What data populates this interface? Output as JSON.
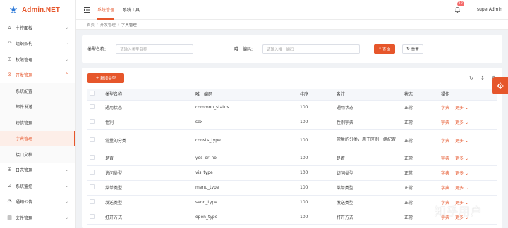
{
  "app": {
    "title": "Admin.NET",
    "brand_color": "#e6562b"
  },
  "sidebar": {
    "items": [
      {
        "label": "主控面板",
        "icon": "home-icon"
      },
      {
        "label": "组织架构",
        "icon": "org-icon"
      },
      {
        "label": "权限管理",
        "icon": "lock-icon"
      },
      {
        "label": "开发管理",
        "icon": "dev-icon",
        "open": true,
        "children": [
          {
            "label": "系统配置"
          },
          {
            "label": "邮件发送"
          },
          {
            "label": "短信管理"
          },
          {
            "label": "字典管理",
            "active": true
          },
          {
            "label": "接口文档"
          }
        ]
      },
      {
        "label": "日志管理",
        "icon": "log-icon"
      },
      {
        "label": "系统监控",
        "icon": "monitor-icon"
      },
      {
        "label": "通知公告",
        "icon": "notice-icon"
      },
      {
        "label": "文件管理",
        "icon": "file-icon"
      }
    ]
  },
  "topbar": {
    "tabs": [
      {
        "label": "系统管理",
        "active": true
      },
      {
        "label": "系统工具"
      }
    ],
    "notification_count": "12",
    "username": "superAdmin"
  },
  "breadcrumb": [
    "首页",
    "开发管理",
    "字典管理"
  ],
  "search": {
    "type_name_label": "类型名称:",
    "type_name_placeholder": "请输入类型名称",
    "code_label": "唯一编码:",
    "code_placeholder": "请输入唯一编码",
    "query_label": "查询",
    "reset_label": "重置"
  },
  "toolbar": {
    "add_label": "新增类型"
  },
  "table": {
    "columns": [
      "类型名称",
      "唯一编码",
      "排序",
      "备注",
      "状态",
      "操作"
    ],
    "rows": [
      {
        "name": "通用状态",
        "code": "common_status",
        "sort": "100",
        "remark": "通用状态",
        "status": "正常"
      },
      {
        "name": "性别",
        "code": "sex",
        "sort": "100",
        "remark": "性别字典",
        "status": "正常"
      },
      {
        "name": "常量的分类",
        "code": "consts_type",
        "sort": "100",
        "remark": "常量的分类，用于区别一组配置",
        "status": "正常",
        "tall": true
      },
      {
        "name": "是否",
        "code": "yes_or_no",
        "sort": "100",
        "remark": "是否",
        "status": "正常"
      },
      {
        "name": "访问类型",
        "code": "vis_type",
        "sort": "100",
        "remark": "访问类型",
        "status": "正常"
      },
      {
        "name": "菜单类型",
        "code": "menu_type",
        "sort": "100",
        "remark": "菜单类型",
        "status": "正常"
      },
      {
        "name": "发送类型",
        "code": "send_type",
        "sort": "100",
        "remark": "发送类型",
        "status": "正常"
      },
      {
        "name": "打开方式",
        "code": "open_type",
        "sort": "100",
        "remark": "打开方式",
        "status": "正常"
      }
    ],
    "op_dict": "字典",
    "op_more": "更多"
  },
  "watermark": "知乎用户"
}
